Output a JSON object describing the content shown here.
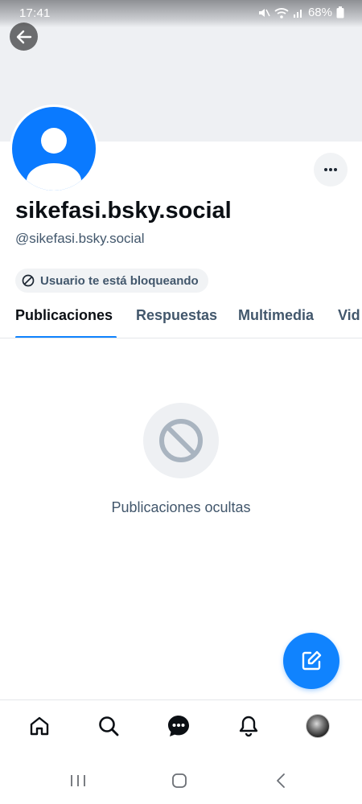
{
  "status_bar": {
    "time": "17:41",
    "battery": "68%"
  },
  "profile": {
    "display_name": "sikefasi.bsky.social",
    "handle": "@sikefasi.bsky.social",
    "blocked_label": "Usuario te está bloqueando"
  },
  "tabs": [
    {
      "label": "Publicaciones",
      "active": true
    },
    {
      "label": "Respuestas",
      "active": false
    },
    {
      "label": "Multimedia",
      "active": false
    },
    {
      "label": "Vid",
      "active": false
    }
  ],
  "empty_state": {
    "message": "Publicaciones ocultas"
  },
  "bottom_nav": {
    "items": [
      "home-icon",
      "search-icon",
      "chat-icon",
      "bell-icon",
      "profile-avatar"
    ]
  },
  "colors": {
    "accent": "#1083fe",
    "avatar_blue": "#0a7aff",
    "secondary_text": "#42576c",
    "banner": "#eef0f3"
  }
}
